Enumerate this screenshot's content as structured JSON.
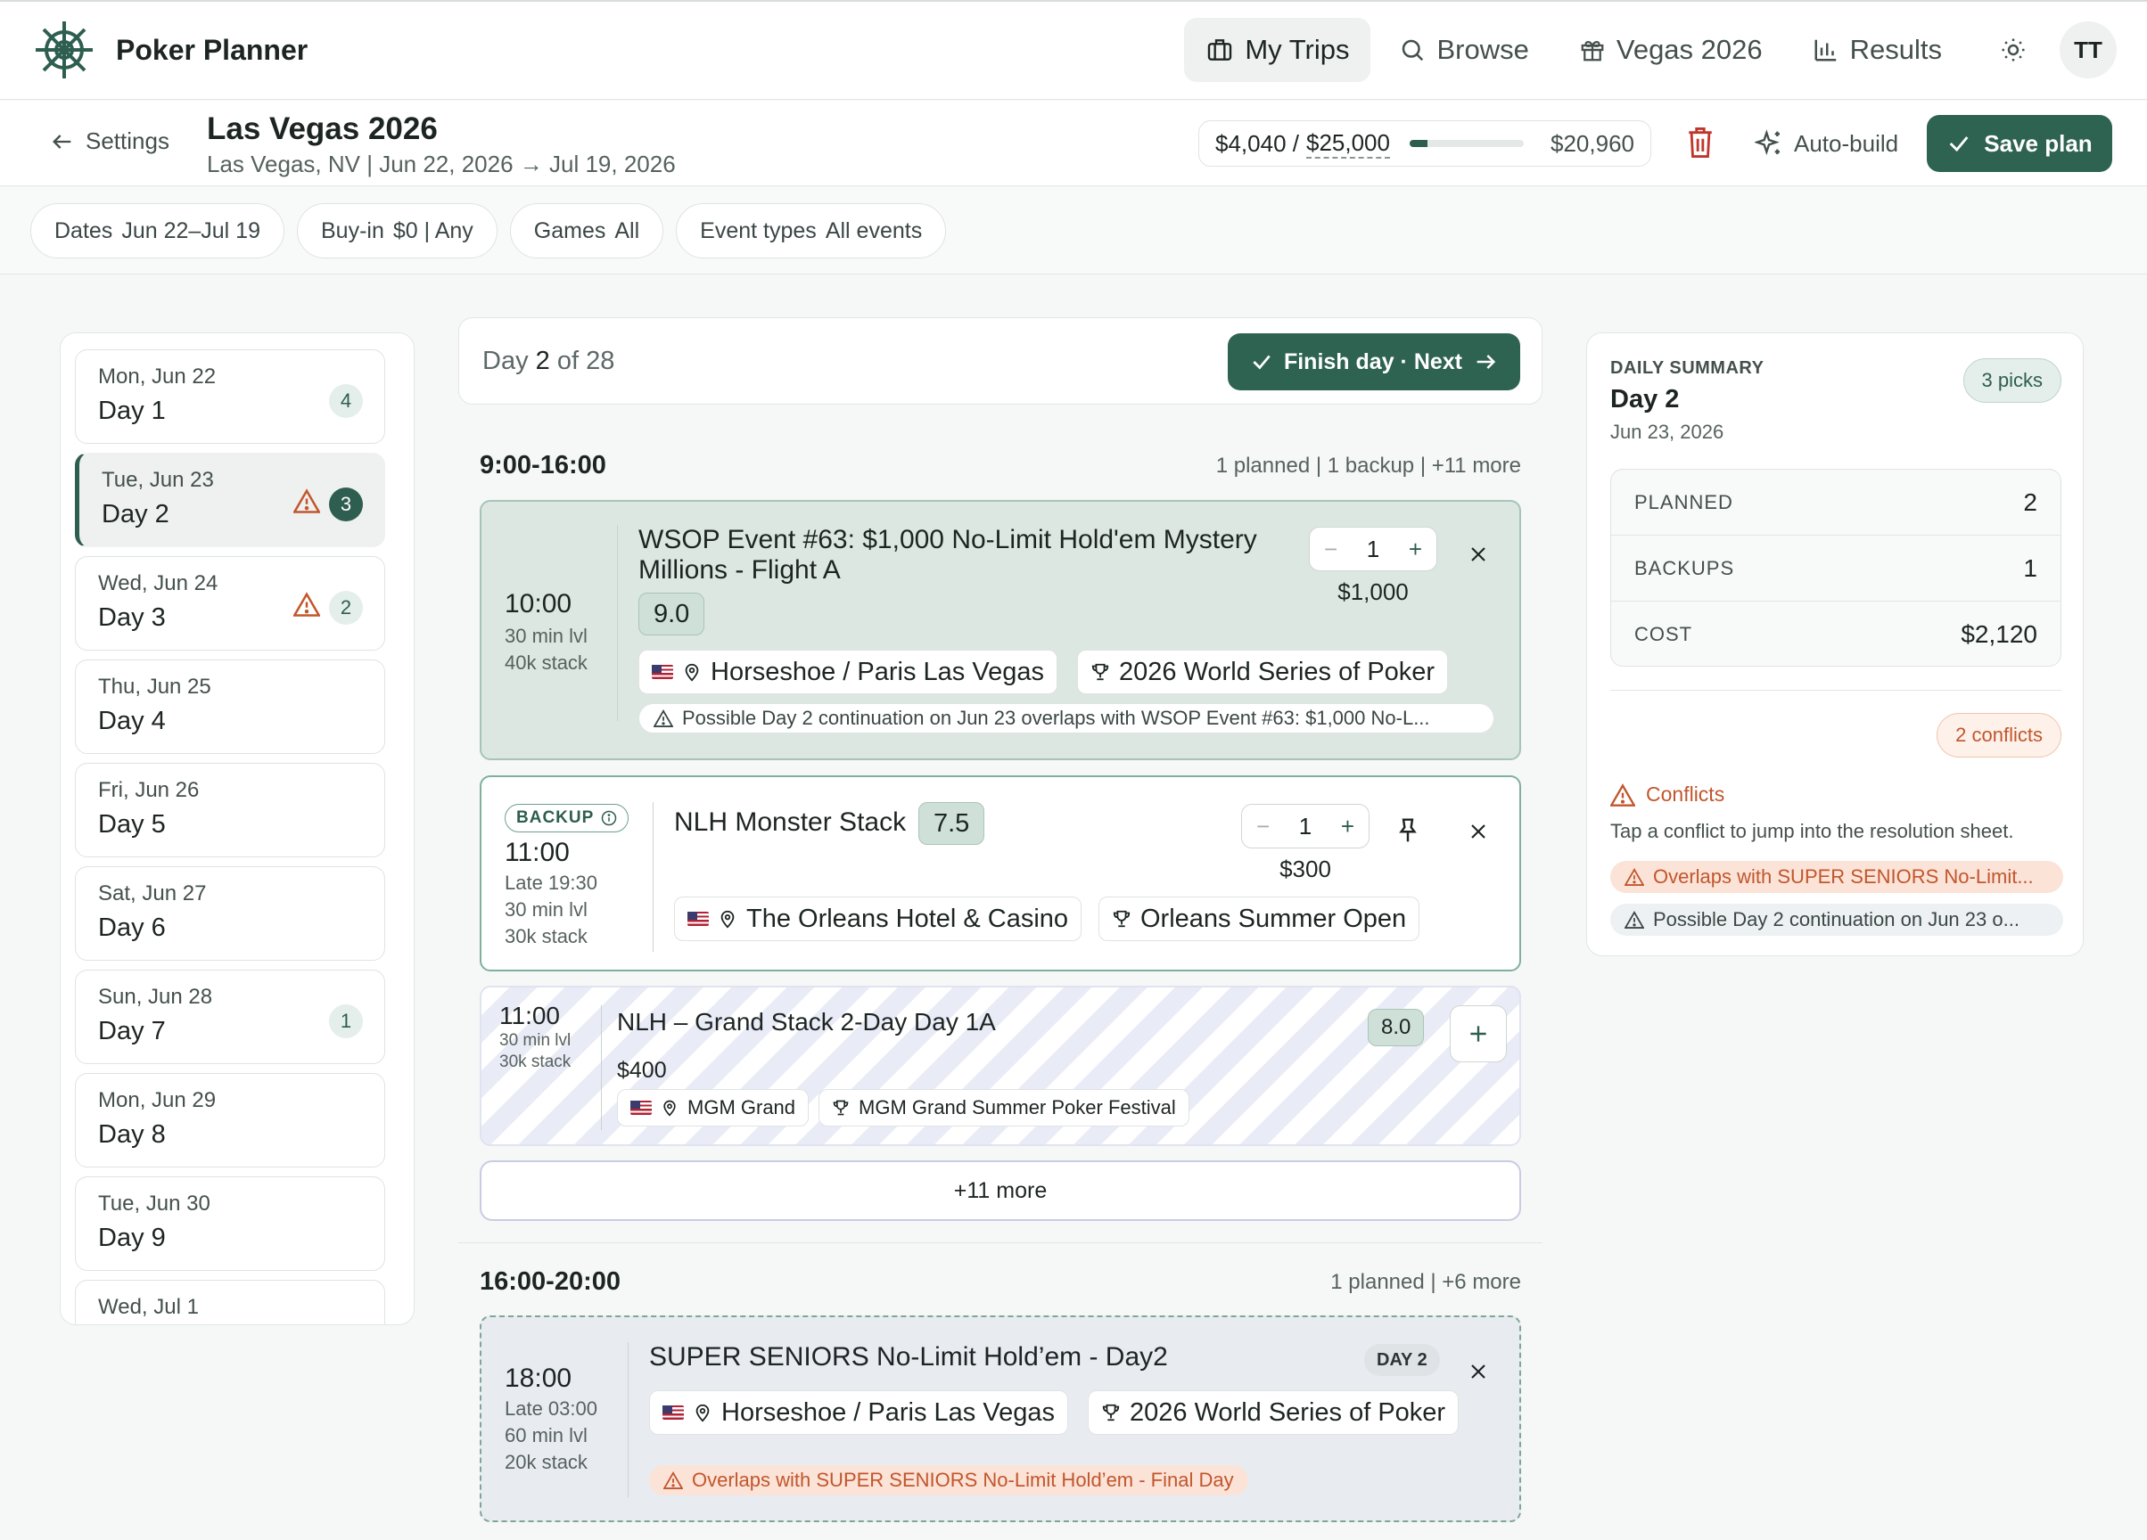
{
  "app": {
    "name": "Poker Planner",
    "logo": "ship-wheel-icon"
  },
  "nav": {
    "items": [
      {
        "label": "My Trips",
        "icon": "luggage-icon",
        "active": true
      },
      {
        "label": "Browse",
        "icon": "search-icon"
      },
      {
        "label": "Vegas 2026",
        "icon": "gift-icon"
      },
      {
        "label": "Results",
        "icon": "bar-chart-icon"
      }
    ],
    "theme_icon": "sun-icon",
    "avatar_initials": "TT"
  },
  "trip": {
    "back_label": "Settings",
    "title": "Las Vegas 2026",
    "subtitle": "Las Vegas, NV | Jun 22, 2026 → Jul 19, 2026",
    "budget": {
      "spent": "$4,040 /",
      "total": "$25,000",
      "remaining": "$20,960",
      "spent_fraction": 0.16
    },
    "autobuild_label": "Auto-build",
    "save_label": "Save plan"
  },
  "filters": [
    {
      "key": "Dates",
      "value": "Jun 22–Jul 19"
    },
    {
      "key": "Buy-in",
      "value": "$0 | Any"
    },
    {
      "key": "Games",
      "value": "All"
    },
    {
      "key": "Event types",
      "value": "All events"
    }
  ],
  "days": [
    {
      "date": "Mon, Jun 22",
      "name": "Day 1",
      "count": "4"
    },
    {
      "date": "Tue, Jun 23",
      "name": "Day 2",
      "count": "3",
      "warning": true,
      "selected": true
    },
    {
      "date": "Wed, Jun 24",
      "name": "Day 3",
      "count": "2",
      "warning": true
    },
    {
      "date": "Thu, Jun 25",
      "name": "Day 4"
    },
    {
      "date": "Fri, Jun 26",
      "name": "Day 5"
    },
    {
      "date": "Sat, Jun 27",
      "name": "Day 6"
    },
    {
      "date": "Sun, Jun 28",
      "name": "Day 7",
      "count": "1"
    },
    {
      "date": "Mon, Jun 29",
      "name": "Day 8"
    },
    {
      "date": "Tue, Jun 30",
      "name": "Day 9"
    },
    {
      "date": "Wed, Jul 1",
      "name": ""
    }
  ],
  "day_header": {
    "prefix": "Day",
    "current": "2",
    "suffix": "of 28",
    "finish_label": "Finish day · Next"
  },
  "slots": [
    {
      "range": "9:00-16:00",
      "meta": "1 planned | 1 backup | +11 more",
      "more_label": "+11 more",
      "events": [
        {
          "time": "10:00",
          "details": [
            "30 min lvl",
            "40k stack"
          ],
          "title_line1": "WSOP Event #63: $1,000 No-Limit Hold'em Mystery",
          "title_line2": "Millions - Flight A",
          "score": "9.0",
          "qty": "1",
          "price": "$1,000",
          "venue": "Horseshoe / Paris Las Vegas",
          "series": "2026 World Series of Poker",
          "conflict": "Possible Day 2 continuation on Jun 23 overlaps with WSOP Event #63: $1,000 No-L..."
        },
        {
          "badge": "BACKUP",
          "time": "11:00",
          "details": [
            "Late 19:30",
            "30 min lvl",
            "30k stack"
          ],
          "title": "NLH Monster Stack",
          "score": "7.5",
          "qty": "1",
          "price": "$300",
          "venue": "The Orleans Hotel & Casino",
          "series": "Orleans Summer Open"
        },
        {
          "time": "11:00",
          "details": [
            "30 min lvl",
            "30k stack"
          ],
          "title": "NLH – Grand Stack 2-Day Day 1A",
          "score": "8.0",
          "price": "$400",
          "venue": "MGM Grand",
          "series": "MGM Grand Summer Poker Festival"
        }
      ]
    },
    {
      "range": "16:00-20:00",
      "meta": "1 planned | +6 more",
      "events": [
        {
          "time": "18:00",
          "details": [
            "Late 03:00",
            "60 min lvl",
            "20k stack"
          ],
          "title": "SUPER SENIORS No-Limit Hold’em - Day2",
          "day_badge": "DAY 2",
          "venue": "Horseshoe / Paris Las Vegas",
          "series": "2026 World Series of Poker",
          "conflict": "Overlaps with SUPER SENIORS No-Limit Hold’em - Final Day"
        }
      ]
    }
  ],
  "summary": {
    "label": "DAILY SUMMARY",
    "day": "Day 2",
    "date": "Jun 23, 2026",
    "picks": "3 picks",
    "stats": [
      {
        "label": "PLANNED",
        "value": "2"
      },
      {
        "label": "BACKUPS",
        "value": "1"
      },
      {
        "label": "COST",
        "value": "$2,120"
      }
    ],
    "conflict_count": "2 conflicts",
    "conflicts_title": "Conflicts",
    "conflicts_desc": "Tap a conflict to jump into the resolution sheet.",
    "conflicts": [
      "Overlaps with SUPER SENIORS No-Limit...",
      "Possible Day 2 continuation on Jun 23 o..."
    ]
  },
  "colors": {
    "brand": "#2e6351",
    "warning": "#c2562d",
    "selected_bg": "#eef1f0"
  }
}
